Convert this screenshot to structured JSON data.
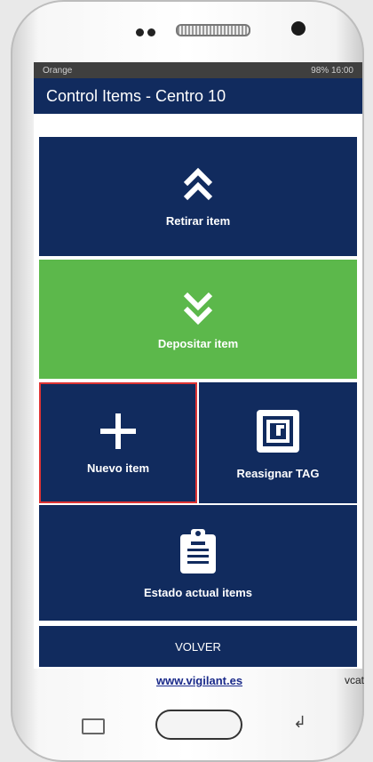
{
  "status_bar": {
    "carrier": "Orange",
    "right": "98% 16:00"
  },
  "app_bar": {
    "title": "Control Items - Centro 10"
  },
  "tiles": {
    "retirar": {
      "label": "Retirar item",
      "icon": "chevron-double-up-icon"
    },
    "depositar": {
      "label": "Depositar item",
      "icon": "chevron-double-down-icon"
    },
    "nuevo": {
      "label": "Nuevo item",
      "icon": "plus-icon"
    },
    "reasignar": {
      "label": "Reasignar TAG",
      "icon": "nfc-tag-icon"
    },
    "estado": {
      "label": "Estado actual items",
      "icon": "clipboard-icon"
    },
    "volver": {
      "label": "VOLVER"
    }
  },
  "footer": {
    "website": "www.vigilant.es",
    "right_text": "vcat"
  },
  "colors": {
    "navy": "#112b5e",
    "green": "#5cb84b",
    "highlight": "#dd3333"
  }
}
